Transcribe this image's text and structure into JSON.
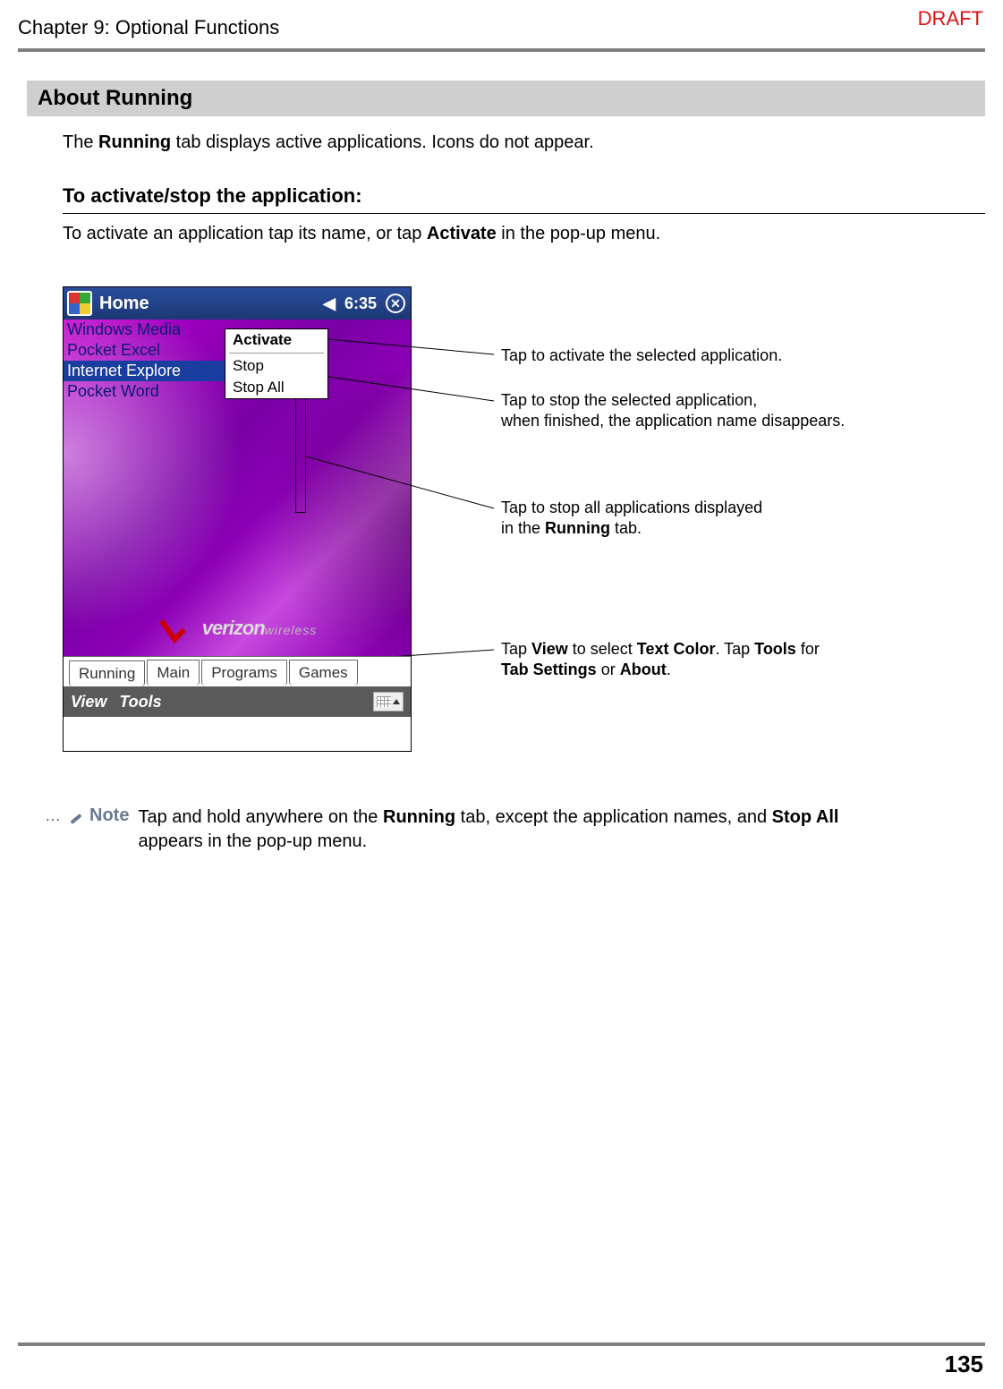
{
  "header": {
    "chapter": "Chapter 9: Optional Functions",
    "draft": "DRAFT"
  },
  "section": {
    "title": "About Running",
    "intro_pre": "The ",
    "intro_bold": "Running",
    "intro_post": " tab displays active applications. Icons do not appear."
  },
  "subsection": {
    "heading": "To activate/stop the application:",
    "body_pre": "To activate an application tap its name, or tap ",
    "body_bold": "Activate",
    "body_post": " in the pop-up menu."
  },
  "device": {
    "titlebar": {
      "label": "Home",
      "time": "6:35"
    },
    "apps": {
      "0": "Windows Media",
      "1": "Pocket Excel",
      "2": "Internet Explore",
      "3": "Pocket Word"
    },
    "menu": {
      "activate": "Activate",
      "stop": "Stop",
      "stop_all": "Stop All"
    },
    "logo": {
      "brand": "verizon",
      "sub": "wireless"
    },
    "tabs": {
      "0": "Running",
      "1": "Main",
      "2": "Programs",
      "3": "Games"
    },
    "menubar": {
      "view": "View",
      "tools": "Tools"
    }
  },
  "callouts": {
    "c1": "Tap to activate the selected application.",
    "c2_l1": "Tap to stop the selected application,",
    "c2_l2": "when finished, the application name disappears.",
    "c3_l1": "Tap to stop all applications displayed",
    "c3_l2_pre": "in the ",
    "c3_l2_bold": "Running",
    "c3_l2_post": " tab.",
    "c4_pre": "Tap ",
    "c4_b1": "View",
    "c4_mid1": " to select ",
    "c4_b2": "Text Color",
    "c4_mid2": ". Tap ",
    "c4_b3": "Tools",
    "c4_mid3": " for",
    "c4_l2_b1": "Tab Settings",
    "c4_l2_mid": " or ",
    "c4_l2_b2": "About",
    "c4_l2_post": "."
  },
  "note": {
    "label": "Note",
    "t1": "Tap and hold anywhere on the ",
    "b1": "Running",
    "t2": " tab, except the application names, and ",
    "b2": "Stop All",
    "t3": " appears in the pop-up menu."
  },
  "page_number": "135"
}
